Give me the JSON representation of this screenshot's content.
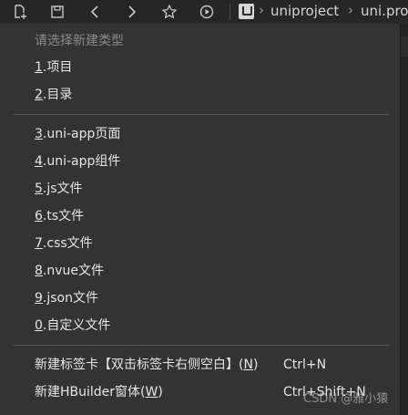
{
  "toolbar": {
    "icons": [
      "new-file-icon",
      "save-icon",
      "back-icon",
      "forward-icon",
      "favorite-star-icon",
      "run-icon"
    ],
    "project_badge_icon": "uniapp-project-icon",
    "breadcrumb": [
      "uniproject",
      "uni.pro"
    ],
    "crumb_separator": "›"
  },
  "menu": {
    "hint": "请选择新建类型",
    "group1": [
      {
        "key": "1",
        "label": ".项目"
      },
      {
        "key": "2",
        "label": ".目录"
      }
    ],
    "group2": [
      {
        "key": "3",
        "label": ".uni-app页面"
      },
      {
        "key": "4",
        "label": ".uni-app组件"
      },
      {
        "key": "5",
        "label": ".js文件"
      },
      {
        "key": "6",
        "label": ".ts文件"
      },
      {
        "key": "7",
        "label": ".css文件"
      },
      {
        "key": "8",
        "label": ".nvue文件"
      },
      {
        "key": "9",
        "label": ".json文件"
      },
      {
        "key": "0",
        "label": ".自定义文件"
      }
    ],
    "group3": [
      {
        "label_before": "新建标签卡【双击标签卡右侧空白】(",
        "key": "N",
        "label_after": ")",
        "shortcut": "Ctrl+N"
      },
      {
        "label_before": "新建HBuilder窗体(",
        "key": "W",
        "label_after": ")",
        "shortcut": "Ctrl+Shift+N"
      }
    ]
  },
  "watermark": "CSDN @雅小猿",
  "colors": {
    "menu_bg": "#333333",
    "toolbar_bg": "#262626",
    "text": "#e6e6e6",
    "hint_text": "#8a8a8a",
    "separator": "#5a5a5a"
  }
}
